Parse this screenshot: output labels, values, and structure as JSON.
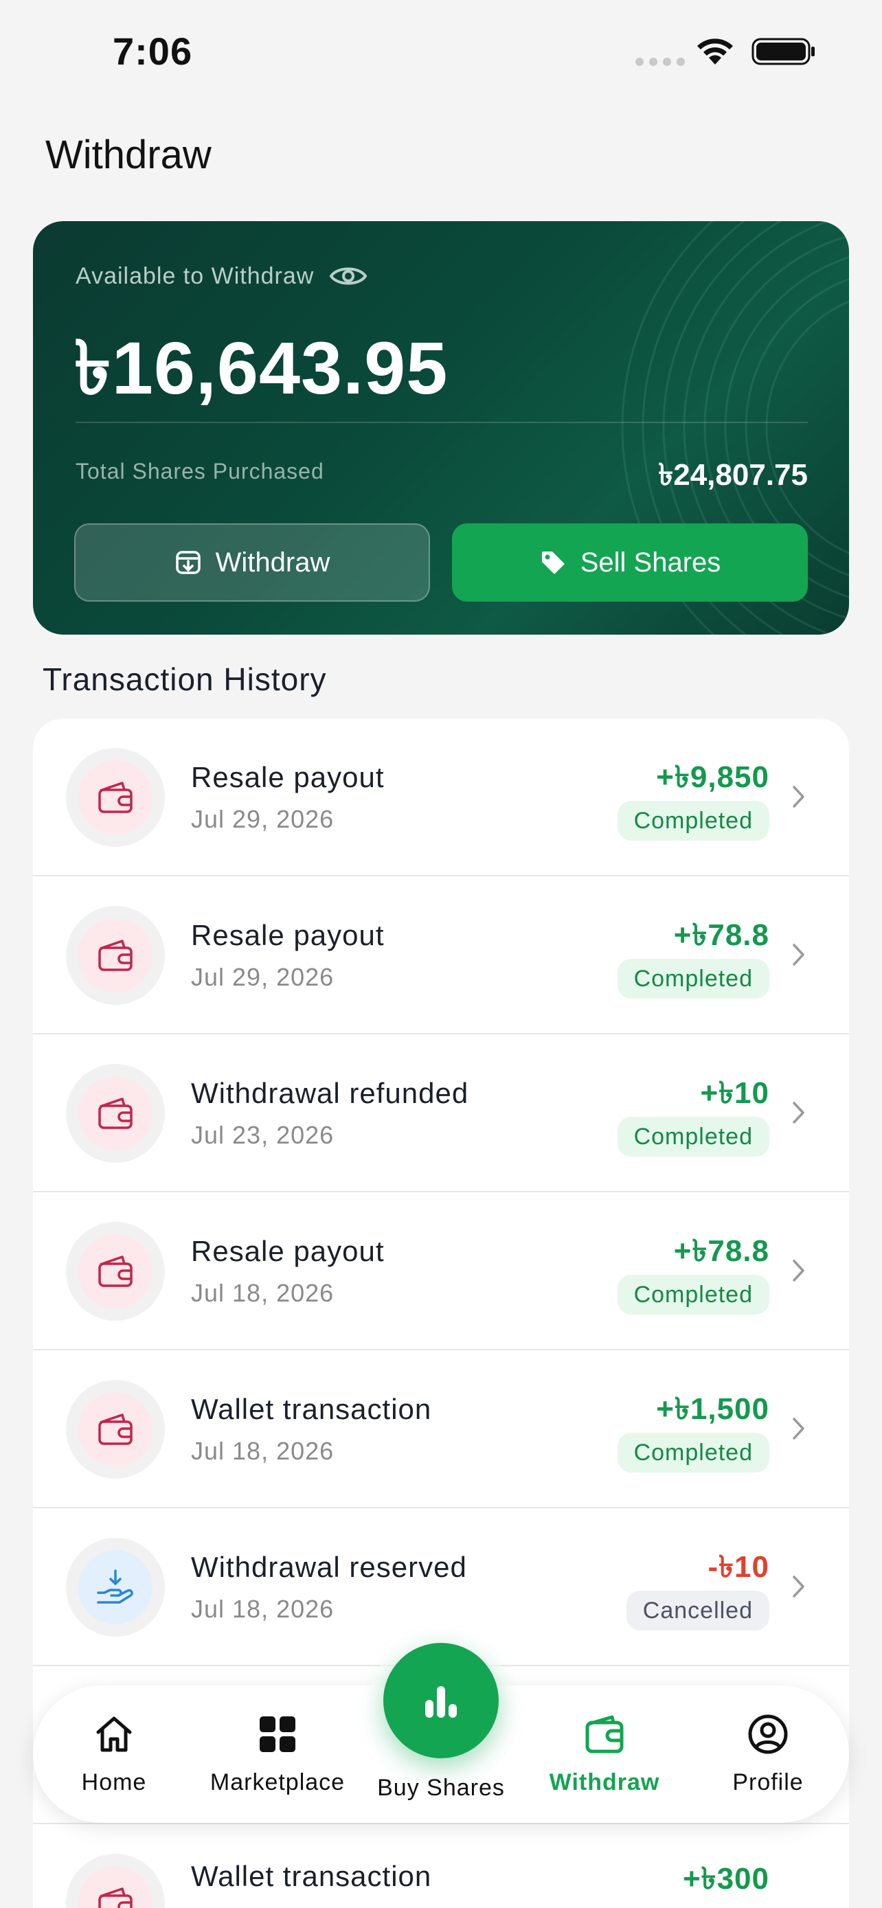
{
  "status_bar": {
    "time": "7:06"
  },
  "page": {
    "title": "Withdraw"
  },
  "balance_card": {
    "available_label": "Available to Withdraw",
    "balance": "৳16,643.95",
    "total_shares_label": "Total Shares Purchased",
    "total_shares_value": "৳24,807.75",
    "withdraw_button": "Withdraw",
    "sell_button": "Sell Shares"
  },
  "transactions": {
    "section_title": "Transaction History",
    "items": [
      {
        "title": "Resale payout",
        "date": "Jul 29, 2026",
        "amount": "+৳9,850",
        "status": "Completed",
        "icon": "wallet-icon"
      },
      {
        "title": "Resale payout",
        "date": "Jul 29, 2026",
        "amount": "+৳78.8",
        "status": "Completed",
        "icon": "wallet-icon"
      },
      {
        "title": "Withdrawal refunded",
        "date": "Jul 23, 2026",
        "amount": "+৳10",
        "status": "Completed",
        "icon": "wallet-icon"
      },
      {
        "title": "Resale payout",
        "date": "Jul 18, 2026",
        "amount": "+৳78.8",
        "status": "Completed",
        "icon": "wallet-icon"
      },
      {
        "title": "Wallet transaction",
        "date": "Jul 18, 2026",
        "amount": "+৳1,500",
        "status": "Completed",
        "icon": "wallet-icon"
      },
      {
        "title": "Withdrawal reserved",
        "date": "Jul 18, 2026",
        "amount": "-৳10",
        "status": "Cancelled",
        "icon": "hand-withdraw-icon"
      },
      {
        "title": "Wallet transaction",
        "date": "",
        "amount": "+৳300",
        "status": "",
        "icon": "wallet-icon"
      }
    ]
  },
  "bottom_nav": {
    "home": "Home",
    "marketplace": "Marketplace",
    "buy_shares": "Buy Shares",
    "withdraw": "Withdraw",
    "profile": "Profile",
    "active": "withdraw"
  },
  "colors": {
    "accent_green": "#13a552",
    "card_dark_green": "#0b3a31",
    "positive_amount": "#14994e",
    "negative_amount": "#e0412f",
    "wallet_icon": "#c2254a"
  }
}
